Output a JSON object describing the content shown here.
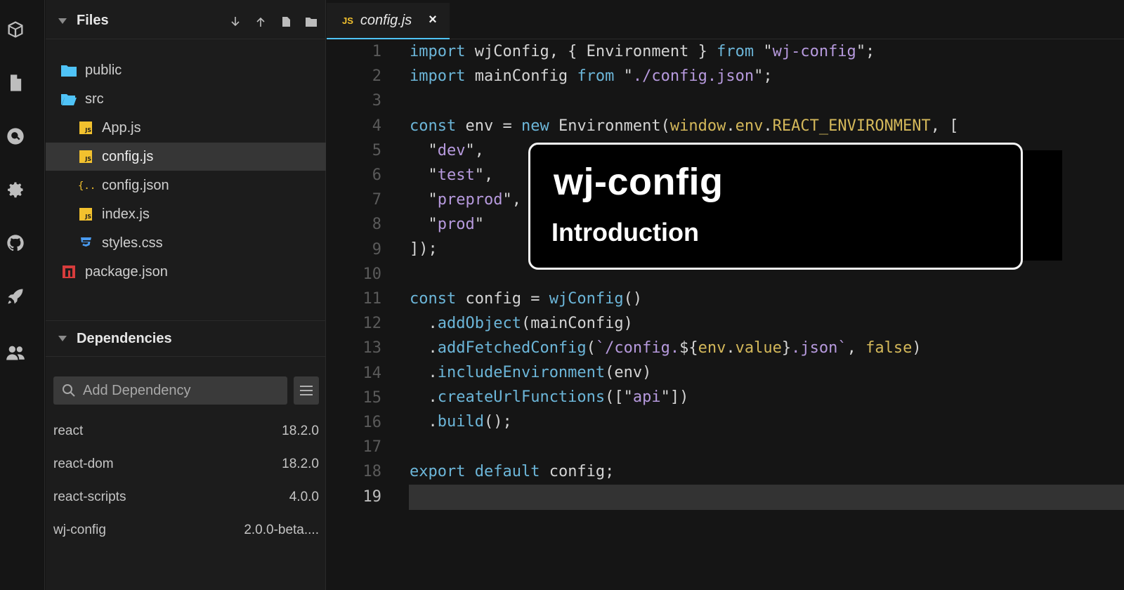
{
  "activity_bar": {
    "icons": [
      "cube-icon",
      "file-icon",
      "search-icon",
      "gear-icon",
      "github-icon",
      "rocket-icon",
      "users-icon"
    ]
  },
  "files_panel": {
    "title": "Files",
    "tools": [
      "download-icon",
      "upload-icon",
      "new-file-icon",
      "new-folder-icon"
    ],
    "items": [
      {
        "name": "public",
        "icon": "folder-icon"
      },
      {
        "name": "src",
        "icon": "folder-open-icon"
      },
      {
        "name": "App.js",
        "icon": "js-file-icon"
      },
      {
        "name": "config.js",
        "icon": "js-file-icon",
        "active": true
      },
      {
        "name": "config.json",
        "icon": "json-file-icon"
      },
      {
        "name": "index.js",
        "icon": "js-file-icon"
      },
      {
        "name": "styles.css",
        "icon": "css-file-icon"
      },
      {
        "name": "package.json",
        "icon": "npm-icon"
      }
    ]
  },
  "dependencies_panel": {
    "title": "Dependencies",
    "search_placeholder": "Add Dependency",
    "items": [
      {
        "name": "react",
        "version": "18.2.0"
      },
      {
        "name": "react-dom",
        "version": "18.2.0"
      },
      {
        "name": "react-scripts",
        "version": "4.0.0"
      },
      {
        "name": "wj-config",
        "version": "2.0.0-beta...."
      }
    ]
  },
  "editor": {
    "tab": {
      "badge": "JS",
      "name": "config.js",
      "close": "×"
    },
    "current_line": 19,
    "line_numbers": [
      "1",
      "2",
      "3",
      "4",
      "5",
      "6",
      "7",
      "8",
      "9",
      "10",
      "11",
      "12",
      "13",
      "14",
      "15",
      "16",
      "17",
      "18",
      "19"
    ]
  },
  "overlay": {
    "title": "wj-config",
    "subtitle": "Introduction"
  },
  "colors": {
    "accent": "#4fc3f7",
    "js_yellow": "#f2c12e",
    "keyword": "#6cb6d9",
    "string": "#b79ade"
  }
}
